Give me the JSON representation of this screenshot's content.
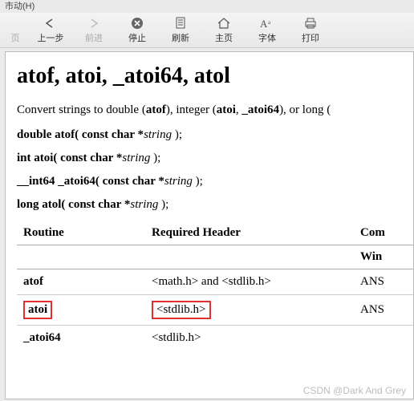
{
  "menubar_fragment": "市动(H)",
  "toolbar": {
    "page_tab": "页",
    "back": "上一步",
    "forward": "前进",
    "stop": "停止",
    "refresh": "刷新",
    "home": "主页",
    "font": "字体",
    "print": "打印"
  },
  "content": {
    "title": "atof, atoi, _atoi64, atol",
    "description_pre": "Convert strings to double (",
    "desc_atof": "atof",
    "desc_mid1": "), integer (",
    "desc_atoi": "atoi",
    "desc_sep": ", ",
    "desc_atoi64": "_atoi64",
    "desc_mid2": "), or long (",
    "sig1_ret": "double atof( const char *",
    "sig1_param": "string",
    "sig1_end": " );",
    "sig2_ret": "int atoi( const char *",
    "sig2_param": "string",
    "sig2_end": " );",
    "sig3_ret": "__int64 _atoi64( const char *",
    "sig3_param": "string",
    "sig3_end": " );",
    "sig4_ret": "long atol( const char *",
    "sig4_param": "string",
    "sig4_end": " );"
  },
  "table": {
    "headers": {
      "routine": "Routine",
      "header": "Required Header",
      "compat": "Com"
    },
    "compat_partial": "Win",
    "rows": [
      {
        "name": "atof",
        "header": "<math.h> and <stdlib.h>",
        "compat": "ANS"
      },
      {
        "name": "atoi",
        "header": "<stdlib.h>",
        "compat": "ANS",
        "highlighted": true
      },
      {
        "name": "_atoi64",
        "header": "<stdlib.h>",
        "compat": ""
      }
    ]
  },
  "watermark": "CSDN @Dark And Grey"
}
